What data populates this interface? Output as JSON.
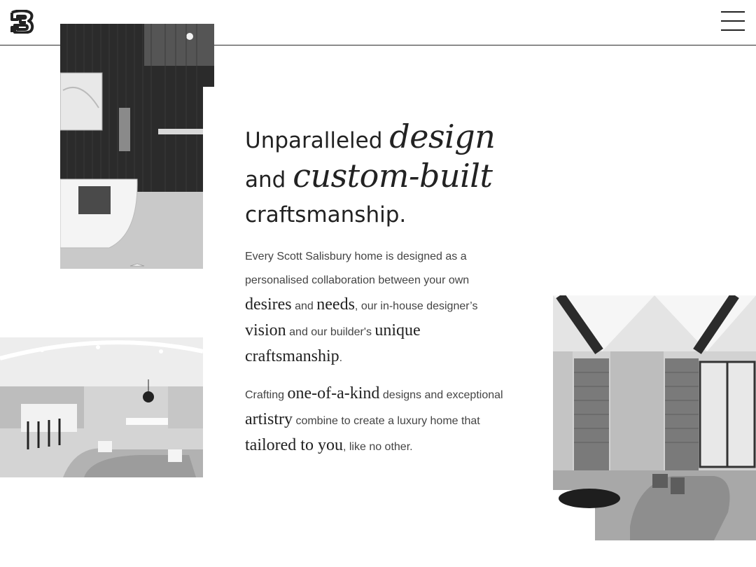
{
  "header": {
    "logo_icon": "brand-logo-icon",
    "menu_icon": "hamburger-menu-icon"
  },
  "headline": {
    "part1": "Unparalleled",
    "part2": "design",
    "part3": "and",
    "part4": "custom-built",
    "part5": "craftsmanship."
  },
  "intro": {
    "t1": "Every Scott Salisbury home is designed as a personalised collaboration between your own",
    "w1": "desires",
    "t2": "and",
    "w2": "needs",
    "t3": ", our in-house designer’s",
    "w3": "vision",
    "t4": "and our builder's",
    "w4": "unique craftsmanship",
    "t5": "."
  },
  "outro": {
    "t1": "Crafting",
    "w1": "one-of-a-kind",
    "t2": "designs and exceptional",
    "w2": "artistry",
    "t3": "combine to create a luxury home that",
    "w3": "tailored to you",
    "t4": ", like no other."
  },
  "colors": {
    "text": "#222222",
    "body_text": "#444444",
    "rule": "#2a2a2a"
  }
}
